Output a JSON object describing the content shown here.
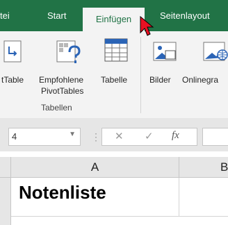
{
  "ribbon_tabs": {
    "datei": "tei",
    "start": "Start",
    "einfuegen": "Einfügen",
    "seitenlayout": "Seitenlayout"
  },
  "ribbon": {
    "pivottable": "tTable",
    "empfohlene_line1": "Empfohlene",
    "empfohlene_line2": "PivotTables",
    "tabelle": "Tabelle",
    "group_tabellen": "Tabellen",
    "bilder": "Bilder",
    "onlinegrafiken": "Onlinegra"
  },
  "formula_bar": {
    "name_box_value": "4",
    "cancel_symbol": "✕",
    "enter_symbol": "✓",
    "function_symbol": "fx"
  },
  "grid": {
    "col_a": "A",
    "col_b": "B",
    "cell_a1": "Notenliste"
  },
  "colors": {
    "ribbon_green": "#217346",
    "ribbon_bg": "#f3f3f3",
    "cursor_red": "#e81123"
  }
}
